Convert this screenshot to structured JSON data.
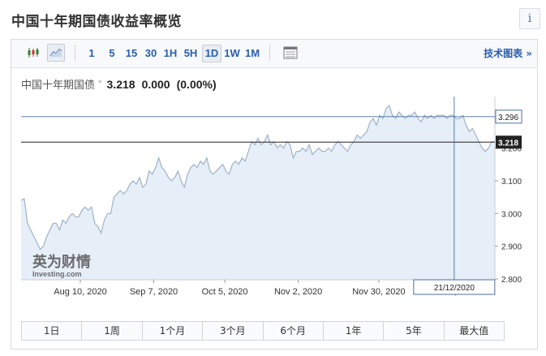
{
  "header": {
    "title": "中国十年期国债收益率概览",
    "info_label": "i"
  },
  "toolbar": {
    "chart_type_icons": [
      "candlestick-icon",
      "area-line-icon"
    ],
    "timeframes": [
      "1",
      "5",
      "15",
      "30",
      "1H",
      "5H",
      "1D",
      "1W",
      "1M"
    ],
    "active_timeframe": "1D",
    "table_icon": "table-icon",
    "tech_chart_link": "技术图表 »"
  },
  "quote": {
    "name": "中国十年期国债",
    "star": "*",
    "value": "3.218",
    "change": "0.000",
    "change_pct": "(0.00%)"
  },
  "watermark": {
    "brand_cn": "英为财情",
    "brand_en": "Investing.com"
  },
  "crosshair": {
    "date_label": "21/12/2020",
    "price_label": "3.296",
    "current_label": "3.218"
  },
  "colors": {
    "line": "#9fb3c8",
    "area": "#e6eef7",
    "crosshair": "#4a6fa5",
    "current_line": "#222222",
    "link": "#2a5db0"
  },
  "ranges": [
    "1日",
    "1周",
    "1个月",
    "3个月",
    "6个月",
    "1年",
    "5年",
    "最大值"
  ],
  "chart_data": {
    "type": "area",
    "title": "",
    "xlabel": "",
    "ylabel": "",
    "ylim": [
      2.8,
      3.36
    ],
    "y_ticks": [
      "3.200",
      "3.100",
      "3.000",
      "2.900",
      "2.800"
    ],
    "x_ticks": [
      "Aug 10, 2020",
      "Sep 7, 2020",
      "Oct 5, 2020",
      "Nov 2, 2020",
      "Nov 30, 2020",
      "Dec 21, 2020"
    ],
    "grid": false,
    "series": [
      {
        "values": [
          3.04,
          3.045,
          2.97,
          2.95,
          2.93,
          2.91,
          2.89,
          2.9,
          2.93,
          2.95,
          2.97,
          2.97,
          2.95,
          2.98,
          2.97,
          2.99,
          3,
          2.99,
          2.99,
          3.01,
          3.02,
          3.01,
          3.02,
          2.97,
          2.96,
          2.94,
          2.98,
          3,
          3,
          3.05,
          3.06,
          3.07,
          3.06,
          3.07,
          3.09,
          3.1,
          3.09,
          3.11,
          3.08,
          3.09,
          3.13,
          3.12,
          3.14,
          3.17,
          3.14,
          3.13,
          3.11,
          3.1,
          3.11,
          3.13,
          3.1,
          3.08,
          3.12,
          3.14,
          3.15,
          3.14,
          3.16,
          3.15,
          3.17,
          3.13,
          3.12,
          3.13,
          3.14,
          3.15,
          3.13,
          3.12,
          3.15,
          3.16,
          3.15,
          3.17,
          3.16,
          3.19,
          3.22,
          3.21,
          3.23,
          3.21,
          3.22,
          3.24,
          3.21,
          3.22,
          3.2,
          3.21,
          3.2,
          3.22,
          3.21,
          3.17,
          3.19,
          3.19,
          3.2,
          3.19,
          3.21,
          3.18,
          3.19,
          3.2,
          3.19,
          3.19,
          3.2,
          3.19,
          3.21,
          3.22,
          3.21,
          3.2,
          3.19,
          3.21,
          3.22,
          3.24,
          3.23,
          3.24,
          3.25,
          3.28,
          3.29,
          3.27,
          3.3,
          3.29,
          3.32,
          3.33,
          3.3,
          3.29,
          3.31,
          3.3,
          3.29,
          3.3,
          3.3,
          3.31,
          3.29,
          3.28,
          3.3,
          3.29,
          3.3,
          3.29,
          3.3,
          3.3,
          3.3,
          3.29,
          3.3,
          3.3,
          3.29,
          3.29,
          3.3,
          3.27,
          3.25,
          3.26,
          3.24,
          3.22,
          3.2,
          3.19,
          3.2,
          3.22,
          3.218
        ]
      }
    ]
  }
}
